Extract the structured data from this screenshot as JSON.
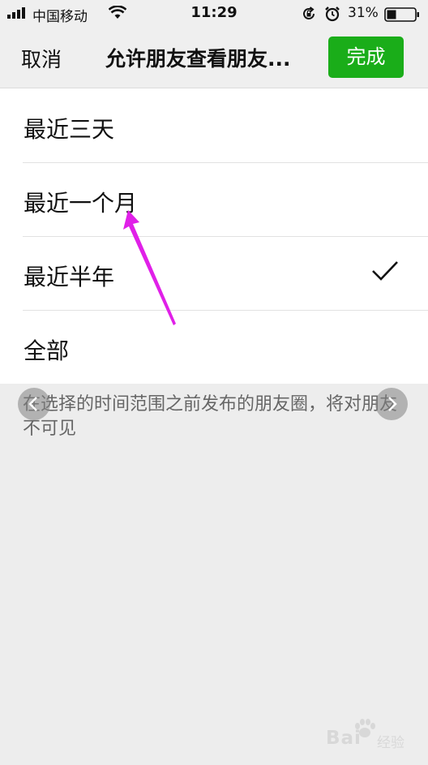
{
  "status_bar": {
    "carrier": "中国移动",
    "time": "11:29",
    "battery_percent": "31%",
    "icons": [
      "signal-icon",
      "wifi-icon",
      "rotation-lock-icon",
      "alarm-icon",
      "battery-icon"
    ]
  },
  "nav": {
    "cancel_label": "取消",
    "title": "允许朋友查看朋友...",
    "done_label": "完成",
    "done_color": "#1aad19"
  },
  "options": [
    {
      "label": "最近三天",
      "selected": false
    },
    {
      "label": "最近一个月",
      "selected": false
    },
    {
      "label": "最近半年",
      "selected": true
    },
    {
      "label": "全部",
      "selected": false
    }
  ],
  "hint": "在选择的时间范围之前发布的朋友圈，将对朋友不可见",
  "annotation_color": "#e020e8",
  "watermark": {
    "brand": "Bai  ",
    "sub": "经验"
  }
}
